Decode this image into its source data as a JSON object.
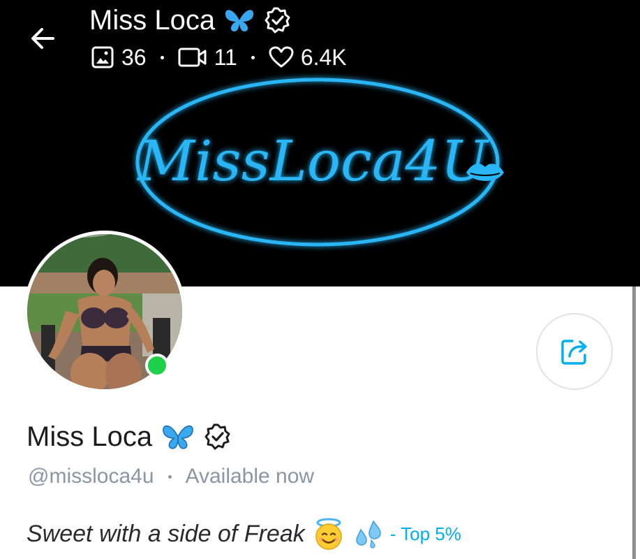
{
  "header": {
    "title": "Miss Loca",
    "stats": {
      "photos": "36",
      "videos": "11",
      "likes": "6.4K"
    }
  },
  "banner": {
    "neon_text": "MissLoca4U"
  },
  "profile": {
    "name": "Miss Loca",
    "handle": "@missloca4u",
    "status": "Available now",
    "bio_text": "Sweet with a side of Freak",
    "bio_tag": "- Top 5%",
    "online": true
  },
  "colors": {
    "accent": "#00aff0",
    "neon": "#29b6f6",
    "online": "#1fd14a",
    "muted": "#8a96a3"
  },
  "icons": [
    "back-arrow-icon",
    "butterfly-icon",
    "verified-badge-icon",
    "photo-icon",
    "video-icon",
    "heart-icon",
    "share-icon",
    "halo-smile-emoji",
    "sweat-droplets-emoji"
  ]
}
